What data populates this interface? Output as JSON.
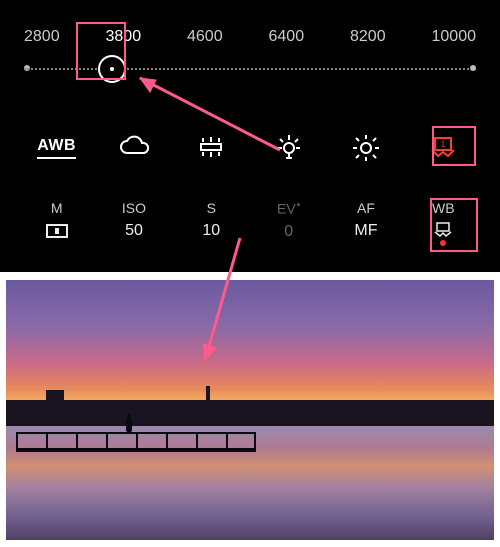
{
  "highlight_color": "#ff5a8a",
  "kelvin_scale": {
    "values": [
      "2800",
      "3800",
      "4600",
      "6400",
      "8200",
      "10000"
    ],
    "selected_index": 1,
    "selected_value": "3800"
  },
  "wb_presets": [
    {
      "name": "awb",
      "label": "AWB"
    },
    {
      "name": "cloudy",
      "label": ""
    },
    {
      "name": "fluorescent",
      "label": ""
    },
    {
      "name": "incandescent",
      "label": ""
    },
    {
      "name": "daylight",
      "label": ""
    },
    {
      "name": "custom-wb",
      "label": "",
      "highlighted": true
    }
  ],
  "settings": [
    {
      "key": "mode",
      "label": "M",
      "value_icon": "center-metering"
    },
    {
      "key": "iso",
      "label": "ISO",
      "value": "50"
    },
    {
      "key": "shutter",
      "label": "S",
      "value": "10"
    },
    {
      "key": "ev",
      "label": "EV",
      "value": "0",
      "badge": "•",
      "dim": true
    },
    {
      "key": "focus",
      "label": "AF",
      "value": "MF"
    },
    {
      "key": "wb",
      "label": "WB",
      "value_icon": "custom-wb-small",
      "highlighted": true
    }
  ],
  "annotations": {
    "arrow_1": "points from near incandescent preset up-left to selected kelvin 3800 knob",
    "arrow_2": "points from shutter value 10 down into the photo area"
  }
}
